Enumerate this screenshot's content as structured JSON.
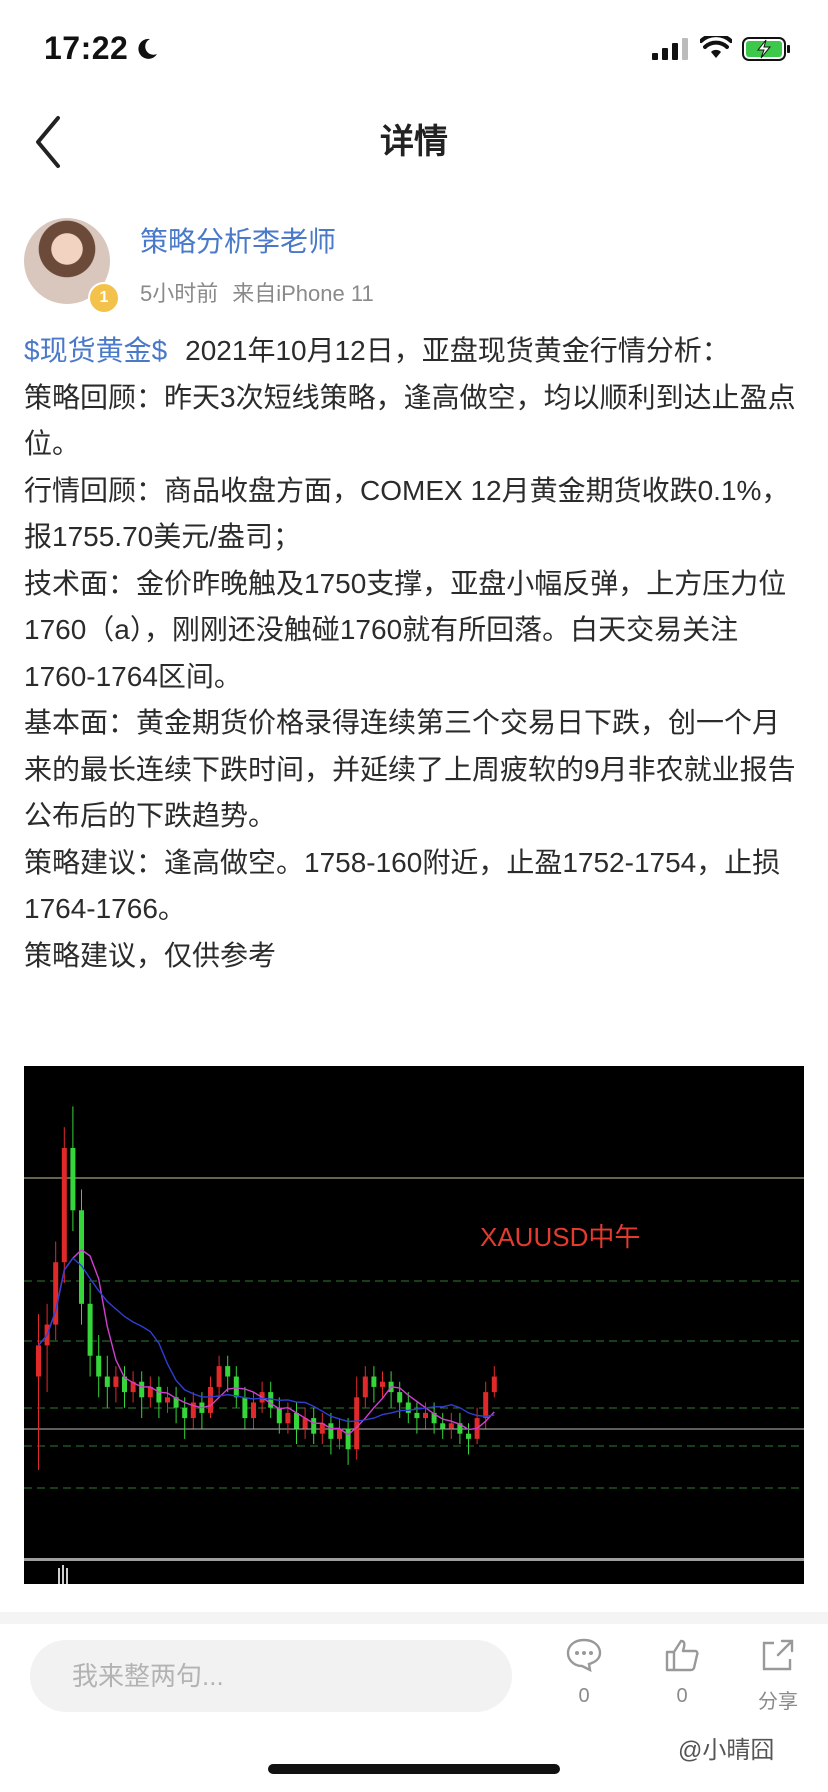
{
  "status": {
    "time": "17:22"
  },
  "nav": {
    "title": "详情"
  },
  "author": {
    "name": "策略分析李老师",
    "badge": "1",
    "time_ago": "5小时前",
    "source": "来自iPhone 11"
  },
  "post": {
    "tag": "$现货黄金$",
    "intro": "2021年10月12日，亚盘现货黄金行情分析：",
    "paragraphs": [
      "策略回顾：昨天3次短线策略，逢高做空，均以顺利到达止盈点位。",
      "行情回顾：商品收盘方面，COMEX 12月黄金期货收跌0.1%，报1755.70美元/盎司；",
      "技术面：金价昨晚触及1750支撑，亚盘小幅反弹，上方压力位1760（a），刚刚还没触碰1760就有所回落。白天交易关注1760-1764区间。",
      "基本面：黄金期货价格录得连续第三个交易日下跌，创一个月来的最长连续下跌时间，并延续了上周疲软的9月非农就业报告公布后的下跌趋势。",
      "策略建议：逢高做空。1758-160附近，止盈1752-1754，止损1764-1766。",
      "策略建议，仅供参考"
    ]
  },
  "chart_data": {
    "type": "candlestick",
    "annotation": "XAUUSD中午",
    "annotation_color": "#e33b2e",
    "up_color": "#e02a2a",
    "down_color": "#35d63a",
    "ohlc": [
      [
        48,
        54,
        30,
        60
      ],
      [
        54,
        58,
        45,
        62
      ],
      [
        58,
        70,
        55,
        74
      ],
      [
        70,
        92,
        66,
        96
      ],
      [
        92,
        80,
        76,
        100
      ],
      [
        80,
        62,
        58,
        84
      ],
      [
        62,
        52,
        48,
        66
      ],
      [
        52,
        48,
        44,
        56
      ],
      [
        48,
        46,
        42,
        52
      ],
      [
        46,
        48,
        43,
        50
      ],
      [
        48,
        45,
        42,
        50
      ],
      [
        45,
        47,
        43,
        49
      ],
      [
        47,
        44,
        40,
        49
      ],
      [
        44,
        46,
        42,
        48
      ],
      [
        46,
        43,
        40,
        48
      ],
      [
        43,
        44,
        41,
        46
      ],
      [
        44,
        42,
        39,
        46
      ],
      [
        42,
        40,
        36,
        44
      ],
      [
        40,
        43,
        38,
        45
      ],
      [
        43,
        41,
        38,
        45
      ],
      [
        41,
        46,
        40,
        48
      ],
      [
        46,
        50,
        44,
        52
      ],
      [
        50,
        48,
        45,
        52
      ],
      [
        48,
        44,
        42,
        50
      ],
      [
        44,
        40,
        38,
        46
      ],
      [
        40,
        43,
        38,
        45
      ],
      [
        43,
        45,
        41,
        47
      ],
      [
        45,
        42,
        40,
        47
      ],
      [
        42,
        39,
        37,
        44
      ],
      [
        39,
        41,
        37,
        43
      ],
      [
        41,
        38,
        35,
        43
      ],
      [
        38,
        40,
        36,
        42
      ],
      [
        40,
        37,
        35,
        42
      ],
      [
        37,
        39,
        35,
        41
      ],
      [
        39,
        36,
        33,
        41
      ],
      [
        36,
        38,
        34,
        40
      ],
      [
        38,
        34,
        31,
        40
      ],
      [
        34,
        44,
        32,
        48
      ],
      [
        44,
        48,
        42,
        50
      ],
      [
        48,
        46,
        43,
        50
      ],
      [
        46,
        47,
        44,
        49
      ],
      [
        47,
        45,
        42,
        49
      ],
      [
        45,
        43,
        40,
        47
      ],
      [
        43,
        41,
        39,
        45
      ],
      [
        41,
        40,
        37,
        43
      ],
      [
        40,
        41,
        38,
        43
      ],
      [
        41,
        39,
        37,
        43
      ],
      [
        39,
        38,
        36,
        41
      ],
      [
        38,
        39,
        36,
        41
      ],
      [
        39,
        37,
        35,
        41
      ],
      [
        37,
        36,
        33,
        39
      ],
      [
        36,
        40,
        35,
        42
      ],
      [
        40,
        45,
        38,
        47
      ],
      [
        45,
        48,
        44,
        50
      ]
    ],
    "ma_series": [
      {
        "name": "",
        "color": "#d040d0"
      },
      {
        "name": "",
        "color": "#2f3fd0"
      }
    ],
    "grid": "dashed-horizontal"
  },
  "bottom": {
    "placeholder": "我来整两句...",
    "comment_count": "0",
    "like_count": "0",
    "share_label": "分享"
  },
  "watermark": "@小晴囧"
}
